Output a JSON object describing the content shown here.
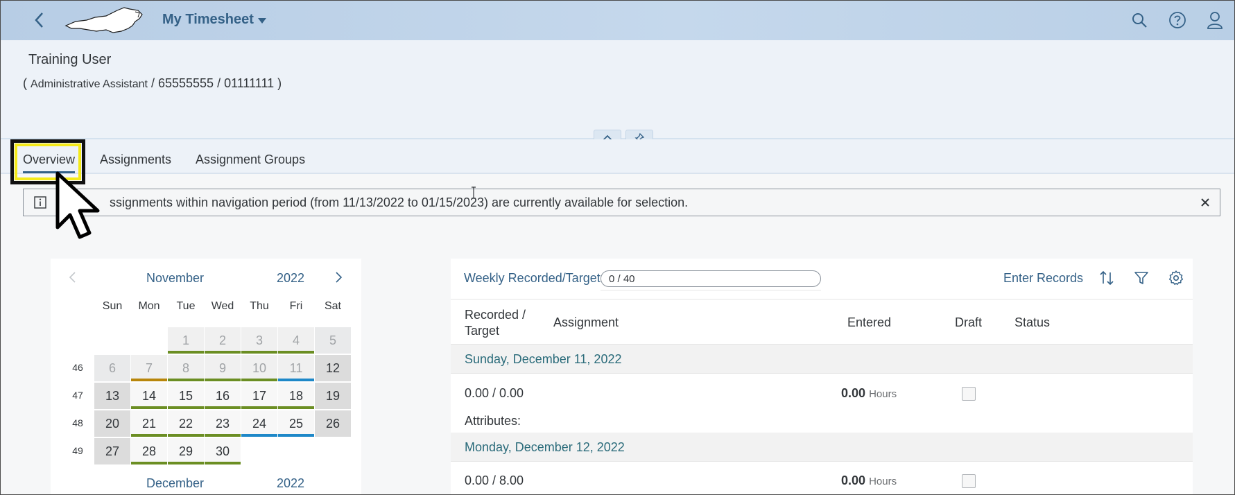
{
  "shell": {
    "title": "My Timesheet",
    "icons": [
      "back-icon",
      "nc-state-logo",
      "search-icon",
      "help-icon",
      "user-icon"
    ]
  },
  "header": {
    "name": "Training User",
    "role": "Administrative Assistant",
    "ids": "/ 65555555 / 01111111 )",
    "open_paren": "("
  },
  "tabs": [
    "Overview",
    "Assignments",
    "Assignment Groups"
  ],
  "message": {
    "text": "ssignments within navigation period (from 11/13/2022 to 01/15/2023) are currently available for selection."
  },
  "calendar": {
    "month": "November",
    "year": "2022",
    "next_month": "December",
    "next_year": "2022",
    "weekdays": [
      "Sun",
      "Mon",
      "Tue",
      "Wed",
      "Thu",
      "Fri",
      "Sat"
    ],
    "weeks": [
      "46",
      "47",
      "48",
      "49"
    ],
    "days": [
      {
        "d": "1",
        "status": "green",
        "muted": true
      },
      {
        "d": "2",
        "status": "green",
        "muted": true
      },
      {
        "d": "3",
        "status": "green",
        "muted": true
      },
      {
        "d": "4",
        "status": "green",
        "muted": true
      },
      {
        "d": "5",
        "status": "none",
        "muted": true
      },
      {
        "d": "6",
        "status": "none",
        "muted": true
      },
      {
        "d": "7",
        "status": "orange",
        "muted": true
      },
      {
        "d": "8",
        "status": "green",
        "muted": true
      },
      {
        "d": "9",
        "status": "green",
        "muted": true
      },
      {
        "d": "10",
        "status": "green",
        "muted": true
      },
      {
        "d": "11",
        "status": "blue",
        "muted": true
      },
      {
        "d": "12",
        "status": "none",
        "muted": false
      },
      {
        "d": "13",
        "status": "none",
        "muted": false
      },
      {
        "d": "14",
        "status": "green",
        "muted": false
      },
      {
        "d": "15",
        "status": "green",
        "muted": false
      },
      {
        "d": "16",
        "status": "green",
        "muted": false
      },
      {
        "d": "17",
        "status": "green",
        "muted": false
      },
      {
        "d": "18",
        "status": "green",
        "muted": false
      },
      {
        "d": "19",
        "status": "none",
        "muted": false
      },
      {
        "d": "20",
        "status": "none",
        "muted": false
      },
      {
        "d": "21",
        "status": "green",
        "muted": false
      },
      {
        "d": "22",
        "status": "green",
        "muted": false
      },
      {
        "d": "23",
        "status": "green",
        "muted": false
      },
      {
        "d": "24",
        "status": "blue",
        "muted": false
      },
      {
        "d": "25",
        "status": "blue",
        "muted": false
      },
      {
        "d": "26",
        "status": "none",
        "muted": false
      },
      {
        "d": "27",
        "status": "none",
        "muted": false
      },
      {
        "d": "28",
        "status": "green",
        "muted": false
      },
      {
        "d": "29",
        "status": "green",
        "muted": false
      },
      {
        "d": "30",
        "status": "green",
        "muted": false
      }
    ]
  },
  "panel": {
    "weekly_label": "Weekly Recorded/Target",
    "weekly_value": "0 / 40",
    "enter_records": "Enter Records",
    "columns": {
      "recorded": "Recorded /",
      "target": "Target",
      "assignment": "Assignment",
      "entered": "Entered",
      "draft": "Draft",
      "status": "Status"
    },
    "groups": [
      {
        "label": "Sunday, December 11, 2022",
        "recorded": "0.00 / 0.00",
        "entered": "0.00",
        "unit": "Hours",
        "attributes": "Attributes:"
      },
      {
        "label": "Monday, December 12, 2022",
        "recorded": "0.00 / 8.00",
        "entered": "0.00",
        "unit": "Hours"
      }
    ]
  },
  "colors": {
    "green": "#6b8e23",
    "orange": "#b8860b",
    "blue": "#1e88c8",
    "accent": "#346187"
  }
}
